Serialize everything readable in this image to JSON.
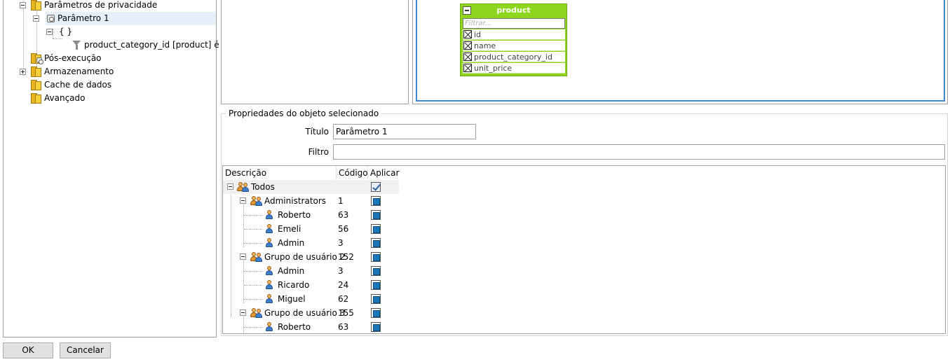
{
  "tree": {
    "items": [
      {
        "label": "Parâmetros de privacidade"
      },
      {
        "label": "Parâmetro 1"
      },
      {
        "label": "{ }"
      },
      {
        "label": "product_category_id [product] é ..."
      },
      {
        "label": "Pós-execução"
      },
      {
        "label": "Armazenamento"
      },
      {
        "label": "Cache de dados"
      },
      {
        "label": "Avançado"
      }
    ]
  },
  "diagram": {
    "table_name": "product",
    "filter_placeholder": "Filtrar...",
    "fields": [
      "id",
      "name",
      "product_category_id",
      "unit_price"
    ]
  },
  "properties": {
    "legend": "Propriedades do objeto selecionado",
    "title_label": "Título",
    "title_value": "Parâmetro 1",
    "filter_label": "Filtro",
    "filter_value": ""
  },
  "grid": {
    "headers": {
      "description": "Descrição",
      "code": "Código",
      "apply": "Aplicar"
    },
    "rows": [
      {
        "description": "Todos",
        "code": "",
        "apply": "checked"
      },
      {
        "description": "Administrators",
        "code": "1",
        "apply": "filled"
      },
      {
        "description": "Roberto",
        "code": "63",
        "apply": "filled"
      },
      {
        "description": "Emeli",
        "code": "56",
        "apply": "filled"
      },
      {
        "description": "Admin",
        "code": "3",
        "apply": "filled"
      },
      {
        "description": "Grupo de usuário 2",
        "code": "152",
        "apply": "filled"
      },
      {
        "description": "Admin",
        "code": "3",
        "apply": "filled"
      },
      {
        "description": "Ricardo",
        "code": "24",
        "apply": "filled"
      },
      {
        "description": "Miguel",
        "code": "62",
        "apply": "filled"
      },
      {
        "description": "Grupo de usuário 3",
        "code": "155",
        "apply": "filled"
      },
      {
        "description": "Roberto",
        "code": "63",
        "apply": "filled"
      }
    ]
  },
  "buttons": {
    "ok": "OK",
    "cancel": "Cancelar"
  }
}
